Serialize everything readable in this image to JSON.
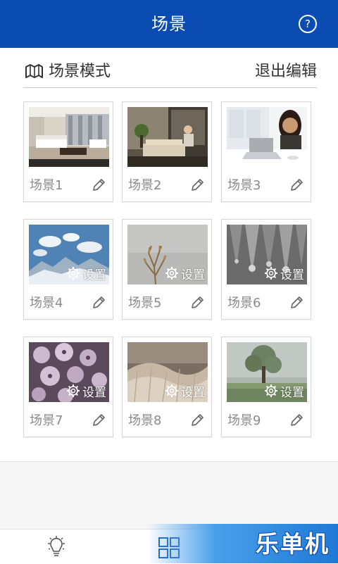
{
  "header": {
    "title": "场景",
    "help_glyph": "?"
  },
  "section": {
    "title": "场景模式",
    "exit_edit_label": "退出编辑"
  },
  "scene_overlay_label": "设置",
  "scenes": [
    {
      "label": "场景1",
      "image": "living-room",
      "has_setting": false
    },
    {
      "label": "场景2",
      "image": "lounge-man",
      "has_setting": false
    },
    {
      "label": "场景3",
      "image": "woman-laptop",
      "has_setting": false
    },
    {
      "label": "场景4",
      "image": "mountain-sky",
      "has_setting": true
    },
    {
      "label": "场景5",
      "image": "dry-plant",
      "has_setting": true
    },
    {
      "label": "场景6",
      "image": "water-drops",
      "has_setting": true
    },
    {
      "label": "场景7",
      "image": "purple-flowers",
      "has_setting": true
    },
    {
      "label": "场景8",
      "image": "reed-grass",
      "has_setting": true
    },
    {
      "label": "场景9",
      "image": "tree-field",
      "has_setting": true
    }
  ],
  "bottom_nav": [
    {
      "icon": "lightbulb-icon",
      "active": false
    },
    {
      "icon": "grid-icon",
      "active": true
    }
  ],
  "watermark": {
    "text": "乐单机"
  },
  "colors": {
    "header": "#0a4cb1",
    "nav_active": "#1e5fc8",
    "label": "#8a8a8a"
  }
}
